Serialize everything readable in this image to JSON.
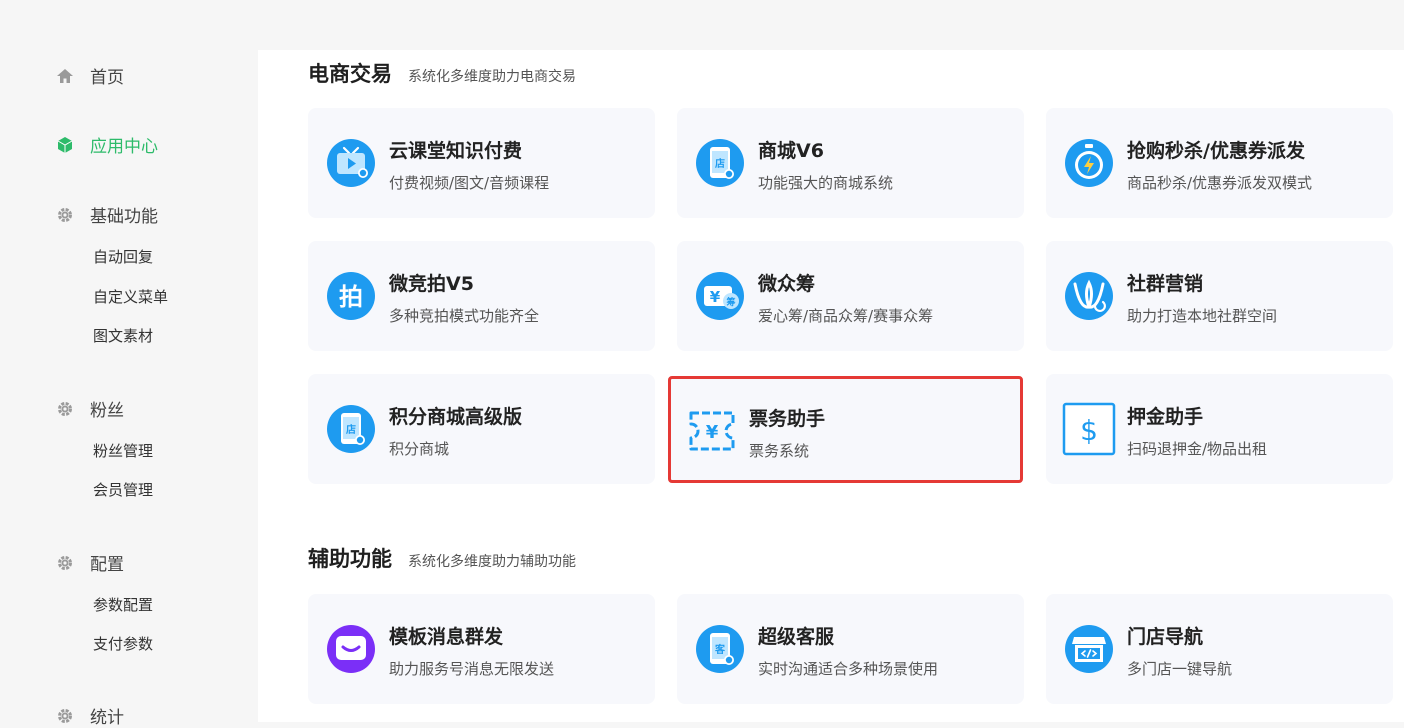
{
  "sidebar": {
    "home": "首页",
    "app_center": "应用中心",
    "basic": "基础功能",
    "auto_reply": "自动回复",
    "custom_menu": "自定义菜单",
    "media": "图文素材",
    "fans": "粉丝",
    "fans_manage": "粉丝管理",
    "member_manage": "会员管理",
    "config": "配置",
    "param_config": "参数配置",
    "pay_param": "支付参数",
    "stats": "统计"
  },
  "sections": {
    "ecommerce": {
      "title": "电商交易",
      "subtitle": "系统化多维度助力电商交易"
    },
    "assist": {
      "title": "辅助功能",
      "subtitle": "系统化多维度助力辅助功能"
    }
  },
  "apps": {
    "cloud_class": {
      "name": "云课堂知识付费",
      "desc": "付费视频/图文/音频课程",
      "icon": "tv-play-icon"
    },
    "mall_v6": {
      "name": "商城V6",
      "desc": "功能强大的商城系统",
      "icon": "shop-phone-icon"
    },
    "flash_sale": {
      "name": "抢购秒杀/优惠券派发",
      "desc": "商品秒杀/优惠券派发双模式",
      "icon": "stopwatch-icon"
    },
    "auction": {
      "name": "微竞拍V5",
      "desc": "多种竞拍模式功能齐全",
      "icon": "auction-icon"
    },
    "crowdfund": {
      "name": "微众筹",
      "desc": "爱心筹/商品众筹/赛事众筹",
      "icon": "crowdfund-icon"
    },
    "community": {
      "name": "社群营销",
      "desc": "助力打造本地社群空间",
      "icon": "community-icon"
    },
    "points_mall": {
      "name": "积分商城高级版",
      "desc": "积分商城",
      "icon": "shop-phone-icon"
    },
    "ticket": {
      "name": "票务助手",
      "desc": "票务系统",
      "icon": "ticket-icon"
    },
    "deposit": {
      "name": "押金助手",
      "desc": "扫码退押金/物品出租",
      "icon": "dollar-icon"
    },
    "template_msg": {
      "name": "模板消息群发",
      "desc": "助力服务号消息无限发送",
      "icon": "message-icon"
    },
    "customer_service": {
      "name": "超级客服",
      "desc": "实时沟通适合多种场景使用",
      "icon": "service-phone-icon"
    },
    "store_nav": {
      "name": "门店导航",
      "desc": "多门店一键导航",
      "icon": "store-icon"
    }
  },
  "icon_glyphs": {
    "auction": "拍",
    "shop": "店",
    "service": "客",
    "yuan": "¥",
    "crowd": "筹",
    "dollar": "$"
  },
  "colors": {
    "accent_green": "#2dbb6a",
    "icon_blue": "#1e9bf0",
    "highlight_red": "#e53935",
    "message_purple": "#7b2ff7"
  }
}
